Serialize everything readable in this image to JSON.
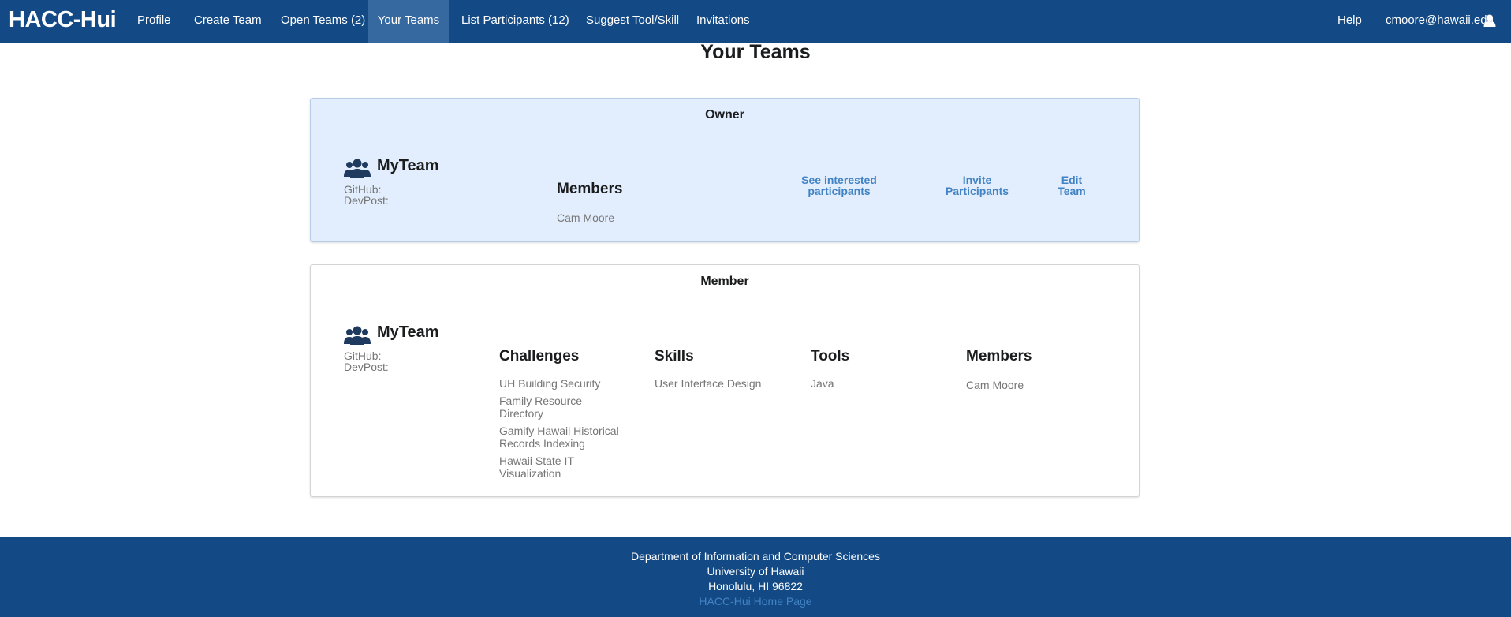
{
  "navbar": {
    "brand": "HACC-Hui",
    "items": [
      "Profile",
      "Create Team",
      "Open Teams (2)",
      "Your Teams",
      "List Participants (12)",
      "Suggest Tool/Skill",
      "Invitations"
    ],
    "active": "Your Teams",
    "help": "Help",
    "user_email": "cmoore@hawaii.edu",
    "user_icon": "user-icon"
  },
  "page": {
    "title": "Your Teams"
  },
  "owner_section": {
    "heading": "Owner",
    "team": {
      "icon": "users-icon",
      "name": "MyTeam",
      "github_label": "GitHub:",
      "devpost_label": "DevPost:"
    },
    "members_heading": "Members",
    "members": [
      "Cam Moore"
    ],
    "actions": {
      "see_interested": [
        "See interested",
        "participants"
      ],
      "invite": [
        "Invite",
        "Participants"
      ],
      "edit": [
        "Edit",
        "Team"
      ]
    }
  },
  "member_section": {
    "heading": "Member",
    "team": {
      "icon": "users-icon",
      "name": "MyTeam",
      "github_label": "GitHub:",
      "devpost_label": "DevPost:"
    },
    "challenges_heading": "Challenges",
    "challenges": [
      [
        "UH Building Security"
      ],
      [
        "Family Resource",
        "Directory"
      ],
      [
        "Gamify Hawaii Historical",
        "Records Indexing"
      ],
      [
        "Hawaii State IT",
        "Visualization"
      ]
    ],
    "skills_heading": "Skills",
    "skills": [
      "User Interface Design"
    ],
    "tools_heading": "Tools",
    "tools": [
      "Java"
    ],
    "members_heading": "Members",
    "members": [
      "Cam Moore"
    ]
  },
  "footer": {
    "line1": "Department of Information and Computer Sciences",
    "line2": "University of Hawaii",
    "line3": "Honolulu, HI 96822",
    "link": "HACC-Hui Home Page"
  },
  "colors": {
    "nav_bg": "#134a85",
    "nav_active": "#3669a0",
    "owner_bg": "#e2eefd",
    "link": "#4183c4"
  }
}
